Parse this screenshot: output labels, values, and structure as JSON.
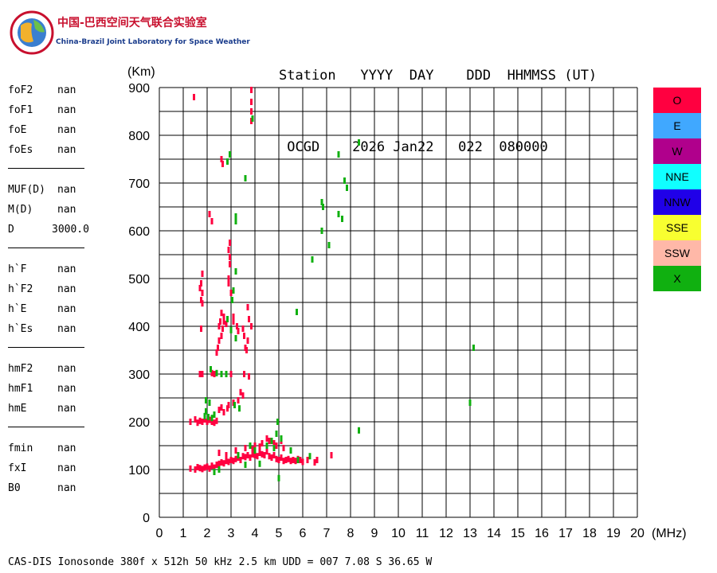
{
  "logo": {
    "name_cn": "中国-巴西空间天气联合实验室",
    "name_en": "China-Brazil Joint Laboratory for Space Weather"
  },
  "header": {
    "line1": "Station   YYYY  DAY    DDD  HHMMSS (UT)",
    "line2": " OCGD    2026 Jan22   022  080000"
  },
  "parameters": [
    {
      "label": "foF2",
      "value": "nan"
    },
    {
      "label": "foF1",
      "value": "nan"
    },
    {
      "label": "foE",
      "value": "nan"
    },
    {
      "label": "foEs",
      "value": "nan"
    },
    {
      "label": "MUF(D)",
      "value": "nan"
    },
    {
      "label": "M(D)",
      "value": "nan"
    },
    {
      "label": "D",
      "value": "3000.0"
    },
    {
      "label": "h`F",
      "value": "nan"
    },
    {
      "label": "h`F2",
      "value": "nan"
    },
    {
      "label": "h`E",
      "value": "nan"
    },
    {
      "label": "h`Es",
      "value": "nan"
    },
    {
      "label": "hmF2",
      "value": "nan"
    },
    {
      "label": "hmF1",
      "value": "nan"
    },
    {
      "label": "hmE",
      "value": "nan"
    },
    {
      "label": "fmin",
      "value": "nan"
    },
    {
      "label": "fxI",
      "value": "nan"
    },
    {
      "label": "B0",
      "value": "nan"
    }
  ],
  "legend": [
    {
      "label": "O",
      "color": "#ff0040"
    },
    {
      "label": "E",
      "color": "#40a8ff"
    },
    {
      "label": "W",
      "color": "#b0008c"
    },
    {
      "label": "NNE",
      "color": "#10ffff"
    },
    {
      "label": "NNW",
      "color": "#2000e8"
    },
    {
      "label": "SSE",
      "color": "#f8ff30"
    },
    {
      "label": "SSW",
      "color": "#ffb8a8"
    },
    {
      "label": "X",
      "color": "#10b010"
    }
  ],
  "footer": "CAS-DIS Ionosonde 380f x 512h 50 kHz 2.5 km UDD = 007 7.08 S 36.65 W",
  "chart_data": {
    "type": "scatter",
    "xlabel": "(MHz)",
    "ylabel": "(Km)",
    "xlim": [
      0,
      20
    ],
    "ylim": [
      0,
      900
    ],
    "xticks": [
      0,
      1,
      2,
      3,
      4,
      5,
      6,
      7,
      8,
      9,
      10,
      11,
      12,
      13,
      14,
      15,
      16,
      17,
      18,
      19,
      20
    ],
    "yticks": [
      0,
      100,
      200,
      300,
      400,
      500,
      600,
      700,
      800,
      900
    ],
    "grid": true,
    "series": [
      {
        "name": "O",
        "color": "#ff0040",
        "points": [
          [
            1.45,
            880
          ],
          [
            2.6,
            750
          ],
          [
            2.65,
            740
          ],
          [
            2.1,
            635
          ],
          [
            2.2,
            620
          ],
          [
            2.95,
            575
          ],
          [
            2.9,
            560
          ],
          [
            2.95,
            545
          ],
          [
            2.95,
            530
          ],
          [
            2.9,
            500
          ],
          [
            2.9,
            490
          ],
          [
            1.8,
            510
          ],
          [
            1.75,
            490
          ],
          [
            1.7,
            480
          ],
          [
            1.8,
            470
          ],
          [
            1.75,
            455
          ],
          [
            1.8,
            448
          ],
          [
            3.0,
            470
          ],
          [
            2.6,
            428
          ],
          [
            2.7,
            420
          ],
          [
            2.55,
            410
          ],
          [
            2.5,
            400
          ],
          [
            2.65,
            395
          ],
          [
            2.5,
            370
          ],
          [
            2.45,
            355
          ],
          [
            2.6,
            380
          ],
          [
            2.4,
            345
          ],
          [
            2.7,
            410
          ],
          [
            2.8,
            405
          ],
          [
            3.1,
            420
          ],
          [
            3.1,
            410
          ],
          [
            3.25,
            400
          ],
          [
            3.3,
            390
          ],
          [
            3.5,
            395
          ],
          [
            3.55,
            380
          ],
          [
            3.7,
            440
          ],
          [
            3.75,
            415
          ],
          [
            3.85,
            400
          ],
          [
            3.7,
            370
          ],
          [
            3.6,
            355
          ],
          [
            3.65,
            350
          ],
          [
            1.75,
            395
          ],
          [
            1.7,
            300
          ],
          [
            1.8,
            300
          ],
          [
            2.2,
            302
          ],
          [
            2.3,
            300
          ],
          [
            3.0,
            300
          ],
          [
            3.55,
            300
          ],
          [
            3.75,
            295
          ],
          [
            3.4,
            262
          ],
          [
            3.5,
            255
          ],
          [
            3.3,
            245
          ],
          [
            3.1,
            240
          ],
          [
            2.9,
            235
          ],
          [
            2.85,
            228
          ],
          [
            2.5,
            225
          ],
          [
            2.6,
            230
          ],
          [
            2.7,
            220
          ],
          [
            1.3,
            200
          ],
          [
            1.5,
            205
          ],
          [
            1.6,
            198
          ],
          [
            1.7,
            202
          ],
          [
            1.8,
            200
          ],
          [
            1.9,
            205
          ],
          [
            2.0,
            200
          ],
          [
            2.1,
            204
          ],
          [
            2.2,
            200
          ],
          [
            2.3,
            198
          ],
          [
            2.4,
            202
          ],
          [
            3.85,
            895
          ],
          [
            3.85,
            870
          ],
          [
            3.85,
            850
          ],
          [
            3.85,
            830
          ],
          [
            1.3,
            102
          ],
          [
            1.5,
            100
          ],
          [
            1.6,
            105
          ],
          [
            1.7,
            103
          ],
          [
            1.8,
            101
          ],
          [
            1.9,
            104
          ],
          [
            2.0,
            106
          ],
          [
            2.1,
            102
          ],
          [
            2.2,
            108
          ],
          [
            2.3,
            104
          ],
          [
            2.4,
            110
          ],
          [
            2.5,
            112
          ],
          [
            2.6,
            115
          ],
          [
            2.7,
            113
          ],
          [
            2.8,
            118
          ],
          [
            2.9,
            116
          ],
          [
            3.0,
            120
          ],
          [
            3.1,
            118
          ],
          [
            3.2,
            122
          ],
          [
            3.3,
            125
          ],
          [
            3.4,
            120
          ],
          [
            3.5,
            128
          ],
          [
            3.6,
            126
          ],
          [
            3.7,
            130
          ],
          [
            3.8,
            125
          ],
          [
            3.9,
            132
          ],
          [
            4.0,
            130
          ],
          [
            4.1,
            128
          ],
          [
            4.2,
            135
          ],
          [
            4.3,
            132
          ],
          [
            4.4,
            130
          ],
          [
            4.5,
            138
          ],
          [
            4.6,
            128
          ],
          [
            4.7,
            125
          ],
          [
            4.8,
            130
          ],
          [
            4.9,
            122
          ],
          [
            5.0,
            120
          ],
          [
            5.1,
            125
          ],
          [
            5.2,
            118
          ],
          [
            5.3,
            120
          ],
          [
            5.4,
            122
          ],
          [
            5.5,
            118
          ],
          [
            5.6,
            120
          ],
          [
            5.7,
            118
          ],
          [
            5.8,
            122
          ],
          [
            5.9,
            120
          ],
          [
            6.0,
            116
          ],
          [
            6.2,
            120
          ],
          [
            6.5,
            115
          ],
          [
            6.6,
            120
          ],
          [
            7.2,
            130
          ],
          [
            2.5,
            135
          ],
          [
            2.8,
            130
          ],
          [
            3.2,
            140
          ],
          [
            3.6,
            145
          ],
          [
            4.0,
            150
          ],
          [
            4.3,
            155
          ],
          [
            4.6,
            160
          ],
          [
            4.9,
            150
          ],
          [
            5.2,
            145
          ],
          [
            5.5,
            140
          ],
          [
            3.9,
            142
          ],
          [
            4.2,
            148
          ],
          [
            4.5,
            165
          ],
          [
            4.8,
            155
          ],
          [
            5.1,
            160
          ]
        ]
      },
      {
        "name": "X",
        "color": "#10b010",
        "points": [
          [
            3.9,
            835
          ],
          [
            8.35,
            785
          ],
          [
            2.95,
            760
          ],
          [
            2.85,
            745
          ],
          [
            3.6,
            710
          ],
          [
            7.5,
            760
          ],
          [
            7.75,
            705
          ],
          [
            7.85,
            690
          ],
          [
            6.8,
            660
          ],
          [
            6.85,
            650
          ],
          [
            3.2,
            630
          ],
          [
            3.2,
            620
          ],
          [
            7.5,
            635
          ],
          [
            7.65,
            625
          ],
          [
            6.8,
            600
          ],
          [
            7.1,
            570
          ],
          [
            6.4,
            540
          ],
          [
            3.2,
            515
          ],
          [
            3.1,
            475
          ],
          [
            3.05,
            455
          ],
          [
            5.75,
            430
          ],
          [
            13.15,
            355
          ],
          [
            2.85,
            415
          ],
          [
            3.0,
            392
          ],
          [
            3.2,
            375
          ],
          [
            2.15,
            310
          ],
          [
            2.4,
            302
          ],
          [
            2.6,
            300
          ],
          [
            2.8,
            300
          ],
          [
            1.95,
            245
          ],
          [
            2.1,
            240
          ],
          [
            1.95,
            222
          ],
          [
            2.05,
            210
          ],
          [
            2.2,
            208
          ],
          [
            3.15,
            235
          ],
          [
            3.35,
            228
          ],
          [
            1.9,
            212
          ],
          [
            2.3,
            215
          ],
          [
            13.0,
            240
          ],
          [
            8.35,
            182
          ],
          [
            4.95,
            200
          ],
          [
            4.9,
            175
          ],
          [
            5.1,
            165
          ],
          [
            4.7,
            160
          ],
          [
            4.5,
            150
          ],
          [
            4.8,
            145
          ],
          [
            5.5,
            140
          ],
          [
            5.0,
            82
          ],
          [
            6.3,
            128
          ],
          [
            5.8,
            120
          ],
          [
            4.0,
            140
          ],
          [
            3.8,
            150
          ],
          [
            2.3,
            95
          ],
          [
            2.5,
            100
          ],
          [
            3.6,
            110
          ],
          [
            4.2,
            112
          ],
          [
            3.3,
            130
          ]
        ]
      }
    ]
  }
}
